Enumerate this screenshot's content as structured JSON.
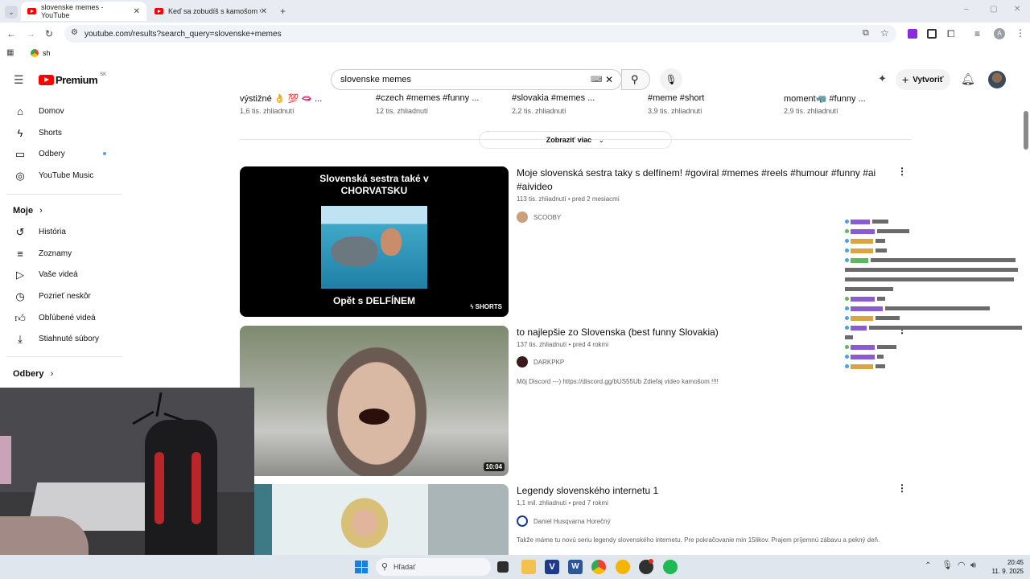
{
  "browser": {
    "tabs": [
      {
        "title": "slovenske memes - YouTube",
        "active": true
      },
      {
        "title": "Keď sa zobudíš s kamošom v p",
        "active": false
      }
    ],
    "url": "youtube.com/results?search_query=slovenske+memes",
    "bookmark": "sh",
    "profile_initial": "A"
  },
  "header": {
    "logo": "Premium",
    "region": "SK",
    "search_value": "slovenske memes",
    "create_label": "Vytvoriť"
  },
  "sidebar": {
    "main": [
      {
        "label": "Domov",
        "icon": "home-icon"
      },
      {
        "label": "Shorts",
        "icon": "shorts-icon"
      },
      {
        "label": "Odbery",
        "icon": "subscriptions-icon"
      },
      {
        "label": "YouTube Music",
        "icon": "music-icon"
      }
    ],
    "you_title": "Moje",
    "you": [
      {
        "label": "História",
        "icon": "history-icon"
      },
      {
        "label": "Zoznamy",
        "icon": "playlists-icon"
      },
      {
        "label": "Vaše videá",
        "icon": "your-videos-icon"
      },
      {
        "label": "Pozrieť neskôr",
        "icon": "watch-later-icon"
      },
      {
        "label": "Obľúbené videá",
        "icon": "liked-icon"
      },
      {
        "label": "Stiahnuté súbory",
        "icon": "downloads-icon"
      }
    ],
    "subs_title": "Odbery"
  },
  "shorts_row": [
    {
      "title": "výstižné 👌 💯 🫦 ...",
      "views": "1,6 tis. zhliadnutí"
    },
    {
      "title": "#czech #memes #funny ...",
      "views": "12 tis. zhliadnutí"
    },
    {
      "title": "#slovakia #memes ...",
      "views": "2,2 tis. zhliadnutí"
    },
    {
      "title": "#meme #short",
      "views": "3,9 tis. zhliadnutí"
    },
    {
      "title": "moment🦏 #funny ...",
      "views": "2,9 tis. zhliadnutí"
    }
  ],
  "show_more": "Zobraziť viac",
  "videos": [
    {
      "title": "Moje slovenská sestra taky s delfínem! #goviral #memes #reels #humour #funny #ai #aivideo",
      "meta": "113 tis. zhliadnutí • pred 2 mesiacmi",
      "channel": "SCOOBY",
      "badge": "SHORTS",
      "thumb_top_text": "Slovenská sestra také v CHORVATSKU",
      "thumb_bottom_text": "Opět s DELFÍNEM",
      "description": ""
    },
    {
      "title": "to najlepšie zo Slovenska (best funny Slovakia)",
      "meta": "137 tis. zhliadnutí • pred 4 rokmi",
      "channel": "DARKPKP",
      "duration": "10:04",
      "description": "Môj Discord ---) https://discord.gg/bUS55Ub Zdieľaj video kamošom !!!!"
    },
    {
      "title": "Legendy slovenského internetu 1",
      "meta": "1,1 mil. zhliadnutí • pred 7 rokmi",
      "channel": "Daniel Husqvarna Horečný",
      "description": "Takže máme tu novú seriu legendy slovenského internetu. Pre pokračovanie min 15likov. Prajem príjemnú zábavu a pekný deň."
    }
  ],
  "taskbar": {
    "search_placeholder": "Hľadať",
    "time": "20:45",
    "date": "11. 9. 2025"
  }
}
